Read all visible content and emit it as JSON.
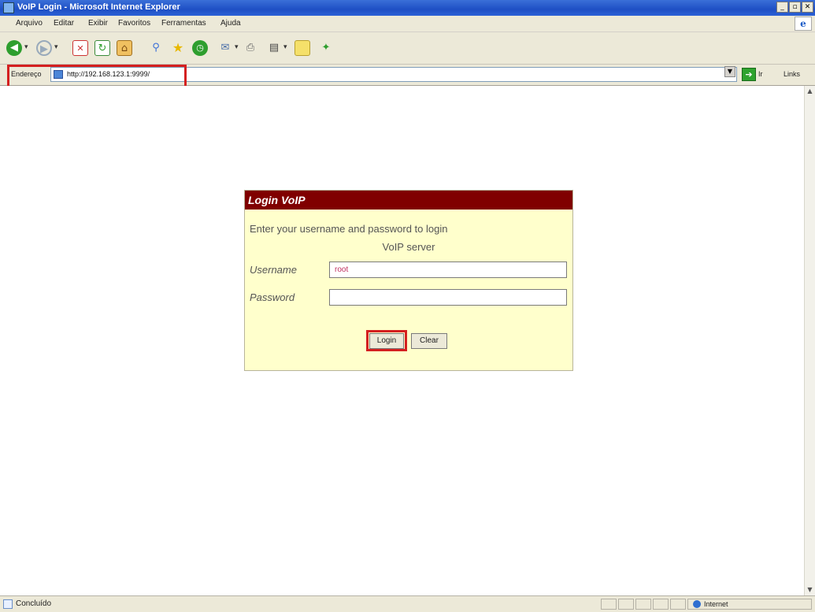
{
  "window": {
    "title": "VoIP Login - Microsoft Internet Explorer",
    "controls": [
      "_",
      "▫",
      "✕"
    ]
  },
  "menu": {
    "items": [
      "Arquivo",
      "Editar",
      "Exibir",
      "Favoritos",
      "Ferramentas",
      "Ajuda"
    ]
  },
  "address_bar": {
    "label": "Endereço",
    "url": "http://192.168.123.1:9999/",
    "go_label": "Ir",
    "links_label": "Links"
  },
  "login": {
    "title": "Login VoIP",
    "message_line1": "Enter your username and password to login",
    "message_line2": "VoIP server",
    "username_label": "Username",
    "username_value": "root",
    "password_label": "Password",
    "password_value": "",
    "login_button": "Login",
    "clear_button": "Clear"
  },
  "status_bar": {
    "text": "Concluído",
    "zone": "Internet"
  },
  "colors": {
    "login_header": "#800000",
    "login_background": "#ffffcc",
    "highlight": "#d42020",
    "titlebar": "#1e4fc4"
  }
}
